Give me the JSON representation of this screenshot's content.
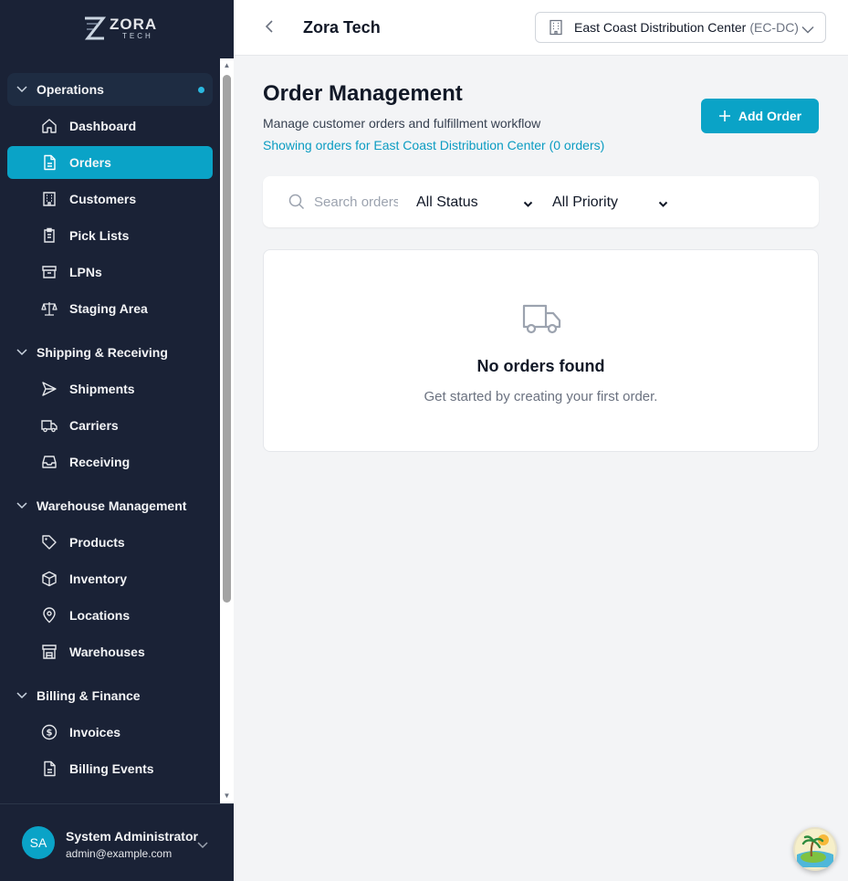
{
  "brand": {
    "name": "ZORA",
    "sub": "TECH"
  },
  "sidebar": {
    "sections": [
      {
        "label": "Operations",
        "items": [
          "Dashboard",
          "Orders",
          "Customers",
          "Pick Lists",
          "LPNs",
          "Staging Area"
        ]
      },
      {
        "label": "Shipping & Receiving",
        "items": [
          "Shipments",
          "Carriers",
          "Receiving"
        ]
      },
      {
        "label": "Warehouse Management",
        "items": [
          "Products",
          "Inventory",
          "Locations",
          "Warehouses"
        ]
      },
      {
        "label": "Billing & Finance",
        "items": [
          "Invoices",
          "Billing Events"
        ]
      }
    ],
    "active_item": "Orders",
    "icons": {
      "dashboard": "home-icon",
      "orders": "document-icon",
      "customers": "building-icon",
      "pick_lists": "clipboard-icon",
      "lpns": "archive-icon",
      "staging_area": "scale-icon",
      "shipments": "send-icon",
      "carriers": "truck-icon",
      "receiving": "inbox-icon",
      "products": "tag-icon",
      "inventory": "cube-icon",
      "locations": "map-pin-icon",
      "warehouses": "store-icon",
      "invoices": "dollar-icon",
      "billing_events": "file-icon"
    }
  },
  "user": {
    "initials": "SA",
    "name": "System Administrator",
    "email": "admin@example.com"
  },
  "header": {
    "company": "Zora Tech",
    "warehouse_name": "East Coast Distribution Center",
    "warehouse_code": "(EC-DC)"
  },
  "page": {
    "title": "Order Management",
    "subtitle": "Manage customer orders and fulfillment workflow",
    "showing": "Showing orders for East Coast Distribution Center (0 orders)",
    "add_button": "Add Order"
  },
  "filters": {
    "search_placeholder": "Search orders...",
    "status": "All Status",
    "priority": "All Priority"
  },
  "empty_state": {
    "title": "No orders found",
    "message": "Get started by creating your first order."
  },
  "colors": {
    "accent": "#0aa3c7",
    "sidebar_bg": "#1a2236",
    "link": "#0b9cc2"
  }
}
